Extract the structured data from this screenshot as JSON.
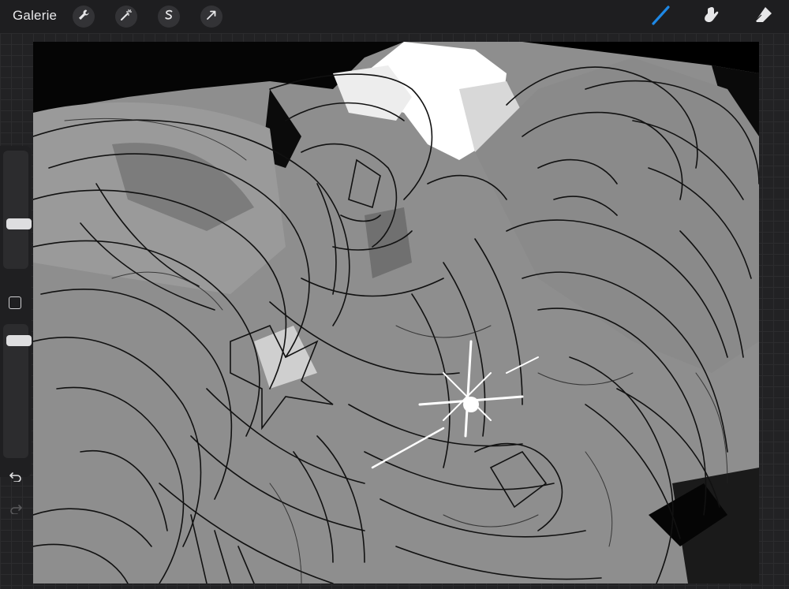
{
  "topbar": {
    "gallery_label": "Galerie",
    "left_tools": [
      {
        "name": "actions",
        "icon": "wrench-icon"
      },
      {
        "name": "adjustments",
        "icon": "magic-wand-icon"
      },
      {
        "name": "selection",
        "icon": "selection-s-icon"
      },
      {
        "name": "transform",
        "icon": "arrow-cursor-icon"
      }
    ],
    "right_tools": [
      {
        "name": "brush",
        "icon": "brush-icon",
        "active": true
      },
      {
        "name": "smudge",
        "icon": "smudge-icon",
        "active": false
      },
      {
        "name": "eraser",
        "icon": "eraser-icon",
        "active": false
      }
    ]
  },
  "sidebar": {
    "brush_size_level": 0.6,
    "opacity_level": 0.95,
    "icons": [
      "modify-square-icon",
      "undo-icon",
      "redo-icon"
    ]
  },
  "colors": {
    "accent": "#1e88e5",
    "ui_bg": "#1e1e20",
    "canvas_base": "#8e8e8e"
  }
}
